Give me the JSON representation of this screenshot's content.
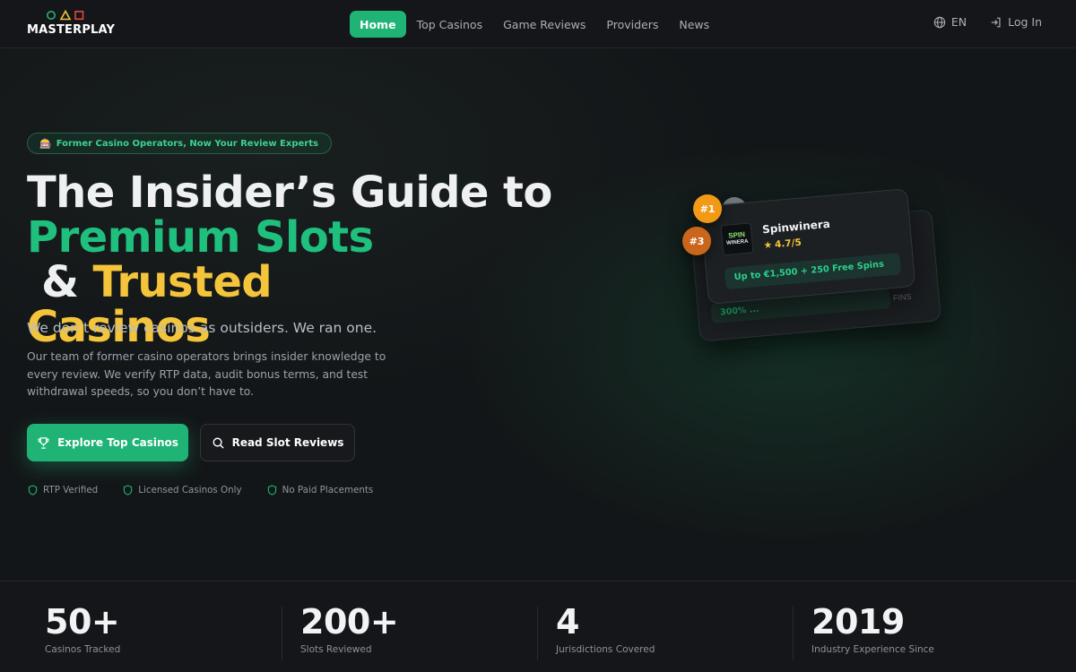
{
  "brand": {
    "name": "MASTERPLAY",
    "accent": "#1fb476",
    "highlight": "#f4c43a"
  },
  "nav": {
    "links": [
      "Home",
      "Top Casinos",
      "Game Reviews",
      "Providers",
      "News"
    ],
    "active": "Home",
    "language": "EN",
    "login": "Log In"
  },
  "hero": {
    "badge_icon": "🎰",
    "badge": "Former Casino Operators, Now Your Review Experts",
    "headline_part1": "The Insider’s Guide to",
    "headline_green": "Premium Slots",
    "headline_amp": " & ",
    "headline_yellow_1": "Trusted",
    "headline_yellow_2": "Casinos",
    "subhead": "We don’t review casinos as outsiders. We ran one.",
    "description": "Our team of former casino operators brings insider knowledge to every review. We verify RTP data, audit bonus terms, and test withdrawal speeds, so you don’t have to.",
    "primary_button": "Explore Top Casinos",
    "secondary_button": "Read Slot Reviews",
    "trust_items": [
      "RTP Verified",
      "Licensed Casinos Only",
      "No Paid Placements"
    ]
  },
  "featured_casinos": {
    "front": {
      "rank": "#1",
      "name": "Spinwinera",
      "logo_text_1": "SPIN",
      "logo_text_2": "WINERA",
      "rating": "4.7/5",
      "offer": "Up to €1,500 + 250 Free Spins"
    },
    "back": {
      "rank": "#3",
      "offer_visible": "300% ...",
      "side_text": "FINS"
    }
  },
  "stats": [
    {
      "value": "50+",
      "label": "Casinos Tracked"
    },
    {
      "value": "200+",
      "label": "Slots Reviewed"
    },
    {
      "value": "4",
      "label": "Jurisdictions Covered"
    },
    {
      "value": "2019",
      "label": "Industry Experience Since"
    }
  ]
}
